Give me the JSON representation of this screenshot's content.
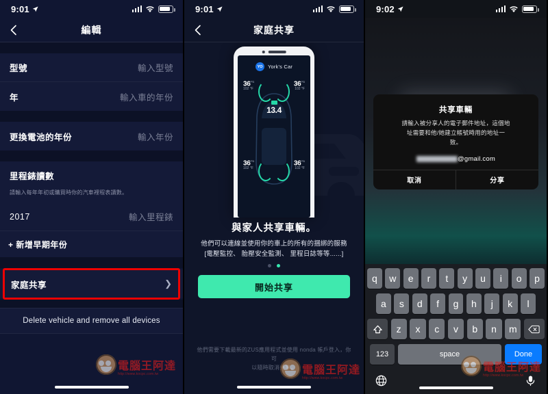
{
  "panel_left": {
    "status": {
      "time": "9:01",
      "location_icon": "location-arrow-icon",
      "signal_icon": "cellular-bars-icon",
      "wifi_icon": "wifi-icon",
      "battery_icon": "battery-icon"
    },
    "nav": {
      "back_icon": "chevron-left-icon",
      "title": "編輯"
    },
    "rows": [
      {
        "label": "型號",
        "value": "輸入型號",
        "filled": false
      },
      {
        "label": "年",
        "value": "輸入車的年份",
        "filled": false
      },
      {
        "label": "更換電池的年份",
        "value": "輸入年份",
        "filled": false
      }
    ],
    "mileage_section": {
      "title": "里程錶讀數",
      "note": "請輸入每年年初或購買時你的汽車裡程表讀數。",
      "year": "2017",
      "placeholder": "輸入里程錶",
      "add_label": "+ 新增早期年份"
    },
    "family_share": {
      "label": "家庭共享",
      "chevron": "chevron-right-icon",
      "highlight_color": "#ee0202"
    },
    "delete_label": "Delete vehicle and remove all devices"
  },
  "panel_middle": {
    "status": {
      "time": "9:01"
    },
    "nav": {
      "back_icon": "chevron-left-icon",
      "title": "家庭共享"
    },
    "phone_preview": {
      "account_initials": "YO",
      "car_name": "York's Car",
      "voltage": "13.4",
      "tires": [
        {
          "psi": "36",
          "unit": "PSI",
          "temp": "102 °F"
        },
        {
          "psi": "36",
          "unit": "PSI",
          "temp": "102 °F"
        },
        {
          "psi": "36",
          "unit": "PSI",
          "temp": "102 °F"
        },
        {
          "psi": "36",
          "unit": "PSI",
          "temp": "102 °F"
        }
      ]
    },
    "title": "與家人共享車輛。",
    "subtitle_line1": "他們可以連線並使用你的車上的所有的捆綁的服務",
    "subtitle_line2": "[電壓監控、 胎壓安全監測、 里程日誌等等......]",
    "page_dots": {
      "count": 2,
      "active_index": 1,
      "active_color": "#38e8b0"
    },
    "cta_label": "開始共享",
    "cta_color": "#3fe9ae",
    "footer_line1": "他們需要下載最新的ZUS應用程式並使用 nonda 帳戶登入，你可",
    "footer_line2": "以隨時取消共享。"
  },
  "panel_right": {
    "status": {
      "time": "9:02"
    },
    "alert": {
      "title": "共享車輛",
      "message_line1": "請輸入被分享人的電子郵件地址，這個地",
      "message_line2": "址需要和他/她建立帳號時用的地址一",
      "message_line3": "致。",
      "email_value": "@gmail.com",
      "cancel_label": "取消",
      "share_label": "分享"
    },
    "keyboard": {
      "row1": [
        "q",
        "w",
        "e",
        "r",
        "t",
        "y",
        "u",
        "i",
        "o",
        "p"
      ],
      "row2": [
        "a",
        "s",
        "d",
        "f",
        "g",
        "h",
        "j",
        "k",
        "l"
      ],
      "row3": [
        "z",
        "x",
        "c",
        "v",
        "b",
        "n",
        "m"
      ],
      "shift_icon": "shift-up-icon",
      "backspace_icon": "backspace-icon",
      "numbers_label": "123",
      "space_label": "space",
      "done_label": "Done",
      "done_color": "#0a7cff",
      "globe_icon": "globe-icon",
      "mic_icon": "microphone-icon"
    }
  },
  "watermark": {
    "text": "電腦王阿達",
    "url": "http://www.kocpc.com.tw"
  }
}
